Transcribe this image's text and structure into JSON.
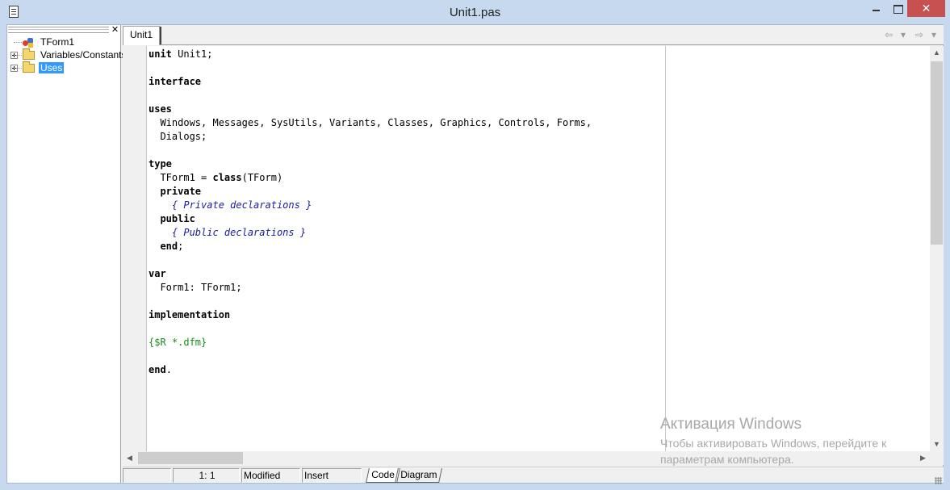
{
  "window": {
    "title": "Unit1.pas",
    "close_glyph": "✕"
  },
  "explorer": {
    "close_glyph": "✕",
    "items": [
      {
        "label": "TForm1",
        "icon": "form-icon",
        "expandable": false,
        "selected": false
      },
      {
        "label": "Variables/Constants",
        "icon": "folder-icon",
        "expandable": true,
        "selected": false
      },
      {
        "label": "Uses",
        "icon": "folder-icon",
        "expandable": true,
        "selected": true
      }
    ]
  },
  "tabs": [
    {
      "label": "Unit1",
      "active": true
    }
  ],
  "navigation": {
    "back_glyph": "⇦",
    "forward_glyph": "⇨",
    "dropdown_glyph": "▾"
  },
  "code_lines": [
    [
      {
        "t": "unit",
        "s": "kw"
      },
      {
        "t": " Unit1;"
      }
    ],
    [],
    [
      {
        "t": "interface",
        "s": "kw"
      }
    ],
    [],
    [
      {
        "t": "uses",
        "s": "kw"
      }
    ],
    [
      {
        "t": "  Windows, Messages, SysUtils, Variants, Classes, Graphics, Controls, Forms,"
      }
    ],
    [
      {
        "t": "  Dialogs;"
      }
    ],
    [],
    [
      {
        "t": "type",
        "s": "kw"
      }
    ],
    [
      {
        "t": "  TForm1 = "
      },
      {
        "t": "class",
        "s": "kw"
      },
      {
        "t": "(TForm)"
      }
    ],
    [
      {
        "t": "  "
      },
      {
        "t": "private",
        "s": "kw"
      }
    ],
    [
      {
        "t": "    "
      },
      {
        "t": "{ Private declarations }",
        "s": "cmt"
      }
    ],
    [
      {
        "t": "  "
      },
      {
        "t": "public",
        "s": "kw"
      }
    ],
    [
      {
        "t": "    "
      },
      {
        "t": "{ Public declarations }",
        "s": "cmt"
      }
    ],
    [
      {
        "t": "  "
      },
      {
        "t": "end",
        "s": "kw"
      },
      {
        "t": ";"
      }
    ],
    [],
    [
      {
        "t": "var",
        "s": "kw"
      }
    ],
    [
      {
        "t": "  Form1: TForm1;"
      }
    ],
    [],
    [
      {
        "t": "implementation",
        "s": "kw"
      }
    ],
    [],
    [
      {
        "t": "{$R *.dfm}",
        "s": "dir"
      }
    ],
    [],
    [
      {
        "t": "end",
        "s": "kw"
      },
      {
        "t": "."
      }
    ]
  ],
  "scrollbars": {
    "up": "▲",
    "down": "▼",
    "left": "◀",
    "right": "▶"
  },
  "statusbar": {
    "position": "1:  1",
    "modified": "Modified",
    "mode": "Insert",
    "bottom_tabs": [
      {
        "label": "Code",
        "active": true
      },
      {
        "label": "Diagram",
        "active": false
      }
    ]
  },
  "watermark": {
    "title": "Активация Windows",
    "line1": "Чтобы активировать Windows, перейдите к",
    "line2": "параметрам компьютера."
  },
  "colors": {
    "keyword": "#000000",
    "comment": "#1a1aa6",
    "directive": "#1a8a1a",
    "selection": "#3399ff",
    "close_button": "#c75050"
  }
}
